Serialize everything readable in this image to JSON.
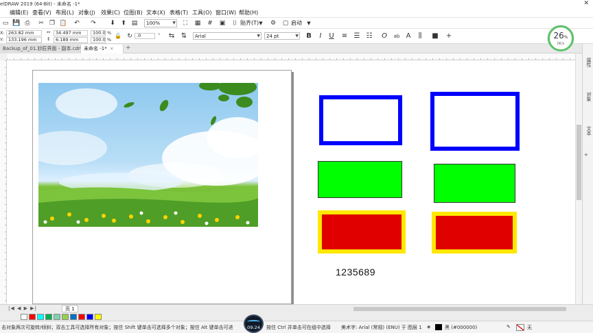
{
  "window": {
    "title": "elDRAW 2019 (64-Bit) - 未命名 -1*",
    "close_glyph": "✕"
  },
  "menu": [
    {
      "label": "编辑(E)",
      "key": "edit"
    },
    {
      "label": "查看(V)",
      "key": "view"
    },
    {
      "label": "布局(L)",
      "key": "layout"
    },
    {
      "label": "对象(J)",
      "key": "object"
    },
    {
      "label": "效果(C)",
      "key": "effects"
    },
    {
      "label": "位图(B)",
      "key": "bitmaps"
    },
    {
      "label": "文本(X)",
      "key": "text"
    },
    {
      "label": "表格(T)",
      "key": "table"
    },
    {
      "label": "工具(O)",
      "key": "tools"
    },
    {
      "label": "窗口(W)",
      "key": "window"
    },
    {
      "label": "帮助(H)",
      "key": "help"
    }
  ],
  "toolbar": {
    "zoom": "100%",
    "snap_label": "贴齐(T)",
    "launch_label": "启动"
  },
  "properties": {
    "x": "263.82 mm",
    "y": "133.196 mm",
    "width": "34.497 mm",
    "height": "6.189 mm",
    "scale_x": "100.0",
    "scale_y": "100.0",
    "pct": "%",
    "rotation": ".0",
    "font": "Arial",
    "font_size": "24 pt",
    "bold": "B",
    "italic": "I",
    "underline": "U",
    "degree": "°"
  },
  "tabs": [
    {
      "label": "Backup_of_01.妙匠界面 - 副本.cdr*",
      "active": false
    },
    {
      "label": "未命名 -1*",
      "active": true
    }
  ],
  "tab_close": "×",
  "tab_add": "+",
  "canvas": {
    "sample_text": "1235689",
    "colors": {
      "blue": "#0000ff",
      "green": "#00ff00",
      "red": "#e00000",
      "yellow": "#ffe800"
    }
  },
  "page_nav": {
    "controls": "|◀ ◀ ▶ ▶|",
    "page_label": "页 1"
  },
  "palette": [
    "#ffffff",
    "#ff0000",
    "#00ffff",
    "#00b050",
    "#7fd4b0",
    "#92d050",
    "#0070c0",
    "#ff0000",
    "#0000ff",
    "#ffff00"
  ],
  "docker": {
    "tab1": "属性",
    "tab2": "对象",
    "tab3": "文本"
  },
  "status": {
    "hint": "击对象两次可旋转/倾斜；双击工具可选择所有对象；按住 Shift 键单击可选择多个对象；按住 Alt 键单击可进",
    "hint2": "按住 Ctrl 并单击可在组中选择",
    "object_info": "美术字: Arial (常规) (ENU) 于 图层 1",
    "fill": "黑 (#000000)",
    "outline": "无"
  },
  "overlay": {
    "timer": "09:24",
    "gauge_value": "26",
    "gauge_unit": "%",
    "gauge_speed": "0K/s"
  }
}
